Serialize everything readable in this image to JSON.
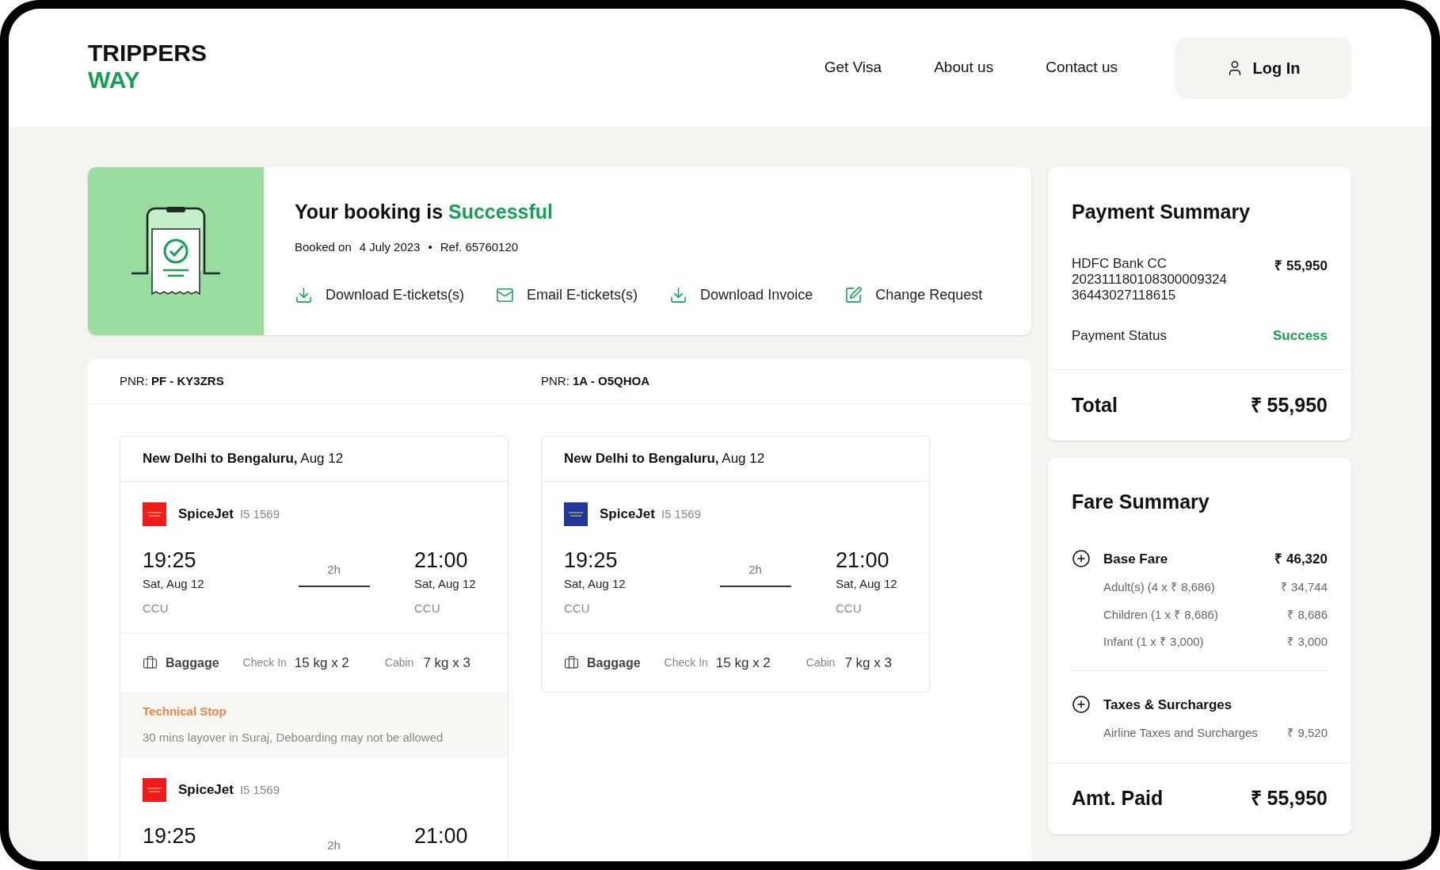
{
  "header": {
    "logo": {
      "line1": "TRIPPERS",
      "line2": "WAY"
    },
    "nav": [
      "Get Visa",
      "About us",
      "Contact us"
    ],
    "login": "Log In"
  },
  "booking": {
    "title": "Your booking is",
    "status": "Successful",
    "booked_on": "Booked on",
    "date": "4 July 2023",
    "separator": "•",
    "ref": "Ref. 65760120",
    "actions": [
      {
        "kind": "download",
        "label": "Download E-tickets(s)"
      },
      {
        "kind": "email",
        "label": "Email E-tickets(s)"
      },
      {
        "kind": "download",
        "label": "Download Invoice"
      },
      {
        "kind": "change",
        "label": "Change Request"
      }
    ]
  },
  "pnrs": [
    {
      "label": "PNR:",
      "code": "PF - KY3ZRS"
    },
    {
      "label": "PNR:",
      "code": "1A - O5QHOA"
    }
  ],
  "itineraries": [
    {
      "route": "New Delhi to Bengaluru,",
      "date": "Aug 12",
      "segments": [
        {
          "kind": "flight",
          "color": "#ee1c1c",
          "airline": "SpiceJet",
          "flight_no": "I5 1569",
          "dep_time": "19:25",
          "dep_date": "Sat, Aug 12",
          "dep_code": "CCU",
          "duration": "2h",
          "arr_time": "21:00",
          "arr_date": "Sat, Aug 12",
          "arr_code": "CCU",
          "baggage": {
            "label": "Baggage",
            "checkin_label": "Check In",
            "checkin": "15 kg x 2",
            "cabin_label": "Cabin",
            "cabin": "7 kg x 3"
          }
        },
        {
          "kind": "stop",
          "title": "Technical Stop",
          "note": "30 mins layover in Suraj, Deboarding may not be allowed"
        },
        {
          "kind": "flight",
          "color": "#ee1c1c",
          "airline": "SpiceJet",
          "flight_no": "I5 1569",
          "dep_time": "19:25",
          "duration": "2h",
          "arr_time": "21:00"
        }
      ]
    },
    {
      "route": "New Delhi to Bengaluru,",
      "date": "Aug 12",
      "segments": [
        {
          "kind": "flight",
          "color": "#23399a",
          "airline": "SpiceJet",
          "flight_no": "I5 1569",
          "dep_time": "19:25",
          "dep_date": "Sat, Aug 12",
          "dep_code": "CCU",
          "duration": "2h",
          "arr_time": "21:00",
          "arr_date": "Sat, Aug 12",
          "arr_code": "CCU",
          "baggage": {
            "label": "Baggage",
            "checkin_label": "Check In",
            "checkin": "15 kg x 2",
            "cabin_label": "Cabin",
            "cabin": "7 kg x 3"
          }
        }
      ]
    }
  ],
  "payment": {
    "title": "Payment Summary",
    "method": [
      "HDFC Bank CC",
      "202311180108300009324",
      "36443027118615"
    ],
    "amount": "₹ 55,950",
    "status_label": "Payment Status",
    "status": "Success",
    "total_label": "Total",
    "total": "₹ 55,950"
  },
  "fare": {
    "title": "Fare Summary",
    "groups": [
      {
        "title": "Base Fare",
        "amount": "₹ 46,320",
        "items": [
          {
            "label": "Adult(s) (4 x ₹ 8,686)",
            "amount": "₹ 34,744"
          },
          {
            "label": "Children (1 x ₹ 8,686)",
            "amount": "₹ 8,686"
          },
          {
            "label": "Infant (1 x ₹ 3,000)",
            "amount": "₹ 3,000"
          }
        ]
      },
      {
        "title": "Taxes & Surcharges",
        "items": [
          {
            "label": "Airline Taxes and Surcharges",
            "amount": "₹ 9,520"
          }
        ]
      }
    ],
    "paid_label": "Amt. Paid",
    "paid": "₹ 55,950"
  }
}
